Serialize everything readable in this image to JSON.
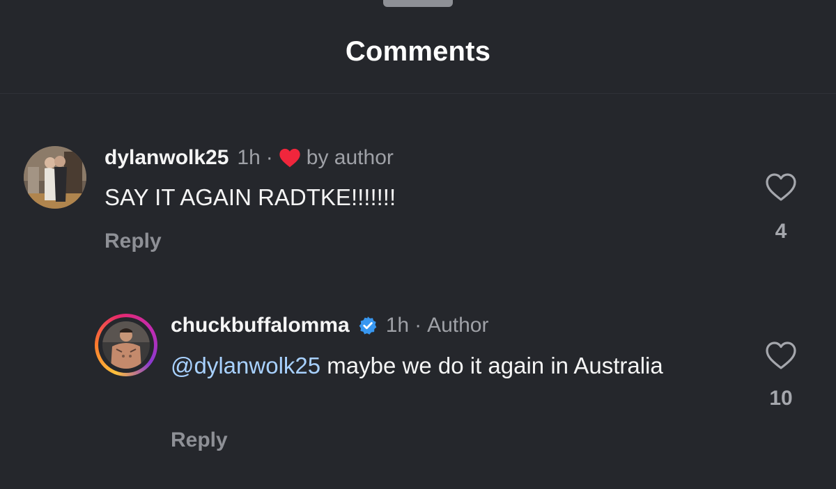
{
  "header": {
    "title": "Comments"
  },
  "comments": [
    {
      "username": "dylanwolk25",
      "time": "1h",
      "separator": "·",
      "author_like_label": "by author",
      "text": "SAY IT AGAIN RADTKE!!!!!!!",
      "reply_label": "Reply",
      "like_count": "4",
      "avatar_icon": "profile-photo",
      "author_like_color": "#f0263c"
    },
    {
      "username": "chuckbuffalomma",
      "verified": true,
      "time": "1h",
      "separator": "·",
      "author_label": "Author",
      "mention": "@dylanwolk25",
      "text": " maybe we do it again in Australia",
      "reply_label": "Reply",
      "like_count": "10",
      "avatar_icon": "profile-photo",
      "verified_color": "#3897f0"
    }
  ],
  "colors": {
    "background": "#25272c",
    "mention": "#a8d1ff",
    "muted": "#9fa1a7"
  }
}
